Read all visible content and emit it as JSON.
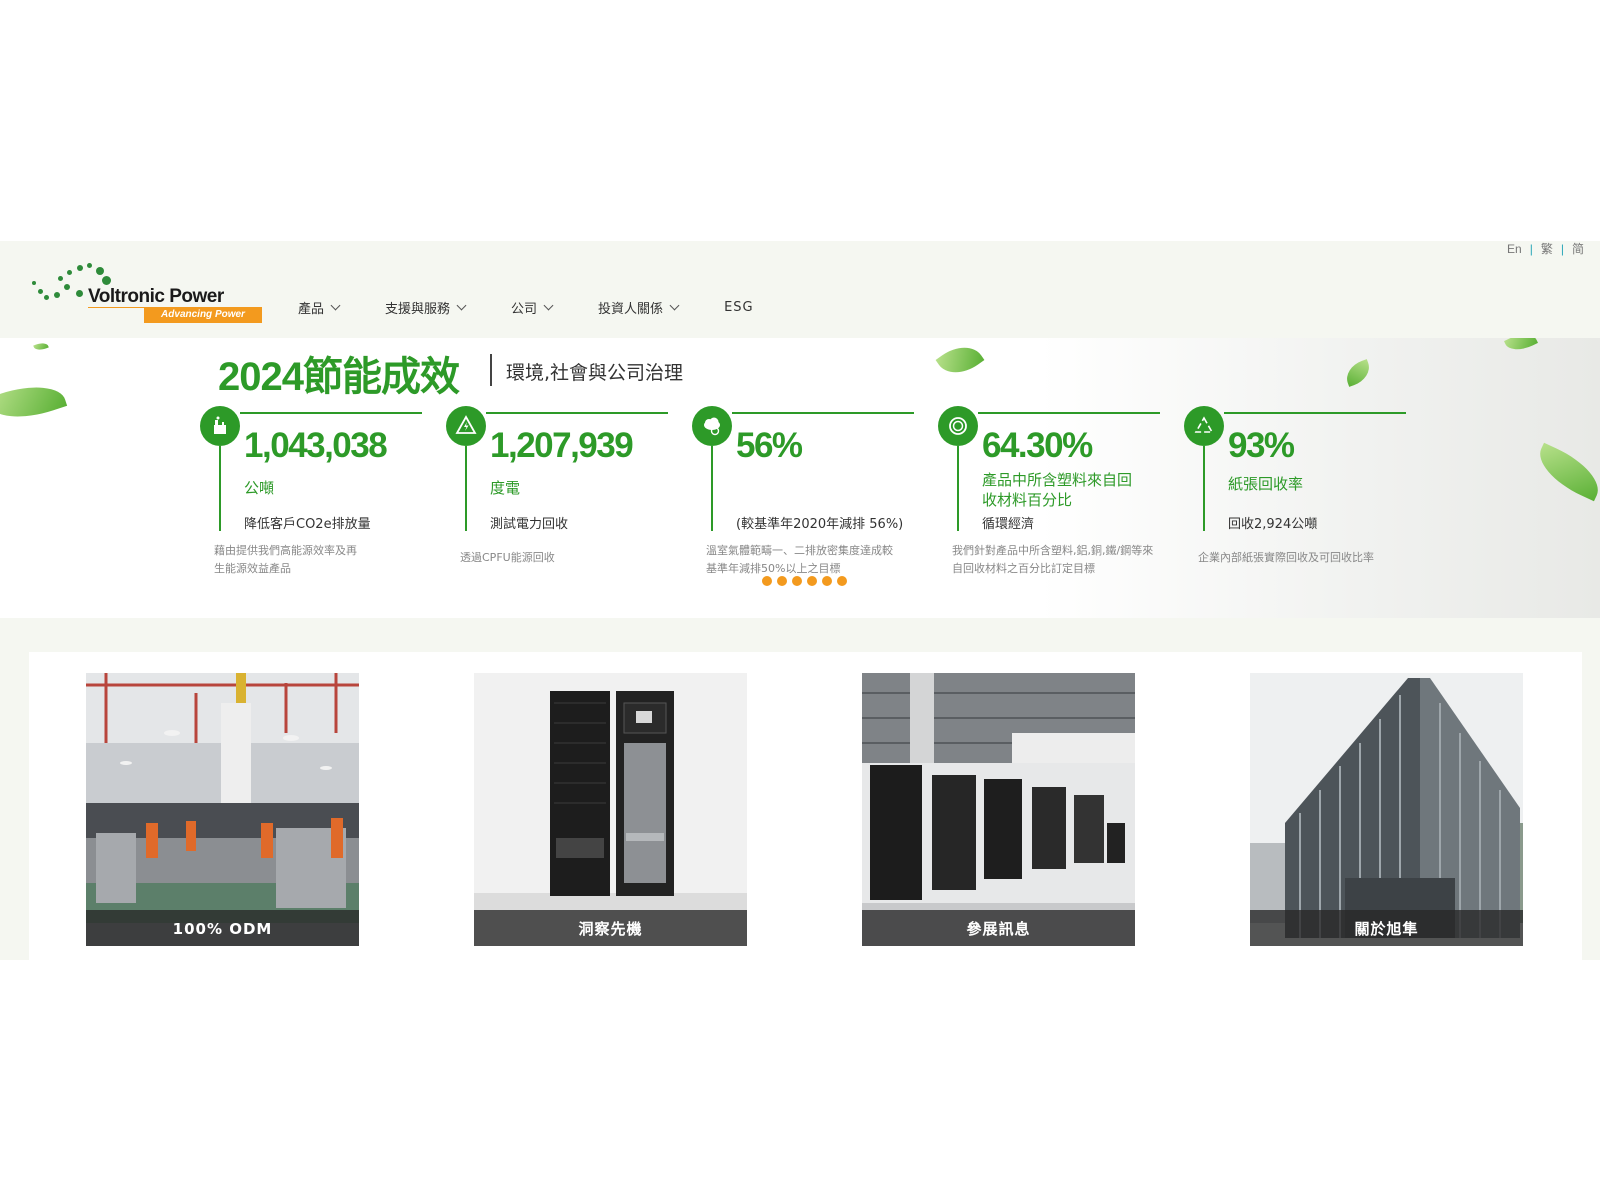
{
  "header": {
    "lang": [
      "En",
      "繁",
      "简"
    ],
    "logo": {
      "name": "Voltronic Power",
      "tagline": "Advancing Power"
    },
    "nav": [
      {
        "label": "產品",
        "dropdown": true
      },
      {
        "label": "支援與服務",
        "dropdown": true
      },
      {
        "label": "公司",
        "dropdown": true
      },
      {
        "label": "投資人關係",
        "dropdown": true
      },
      {
        "label": "ESG",
        "dropdown": false
      }
    ]
  },
  "hero": {
    "title": "2024節能成效",
    "subtitle": "環境,社會與公司治理",
    "stats": [
      {
        "icon": "factory-icon",
        "value": "1,043,038",
        "unit": "公噸",
        "label": "降低客戶CO2e排放量",
        "desc": "藉由提供我們高能源效率及再生能源效益產品"
      },
      {
        "icon": "lightning-icon",
        "value": "1,207,939",
        "unit": "度電",
        "label": "測試電力回收",
        "desc": "透過CPFU能源回收"
      },
      {
        "icon": "cloud-icon",
        "value": "56%",
        "unit": "",
        "label": "(較基準年2020年減排 56%)",
        "desc": "溫室氣體範疇一、二排放密集度達成較基準年減排50%以上之目標"
      },
      {
        "icon": "recycle-circle-icon",
        "value": "64.30%",
        "unit": "產品中所含塑料來自回收材料百分比",
        "label": "循環經濟",
        "desc": "我們針對產品中所含塑料,鋁,銅,鐵/鋼等來自回收材料之百分比訂定目標"
      },
      {
        "icon": "recycle-icon",
        "value": "93%",
        "unit": "紙張回收率",
        "label": "回收2,924公噸",
        "desc": "企業內部紙張實際回收及可回收比率"
      }
    ],
    "carousel_dots": 6,
    "colors": {
      "brand_green": "#2d9a28",
      "accent_orange": "#f39a1e"
    }
  },
  "cards": [
    {
      "caption": "100% ODM",
      "image": "factory-floor"
    },
    {
      "caption": "洞察先機",
      "image": "server-racks"
    },
    {
      "caption": "參展訊息",
      "image": "exhibition-booth"
    },
    {
      "caption": "關於旭隼",
      "image": "office-building"
    }
  ]
}
